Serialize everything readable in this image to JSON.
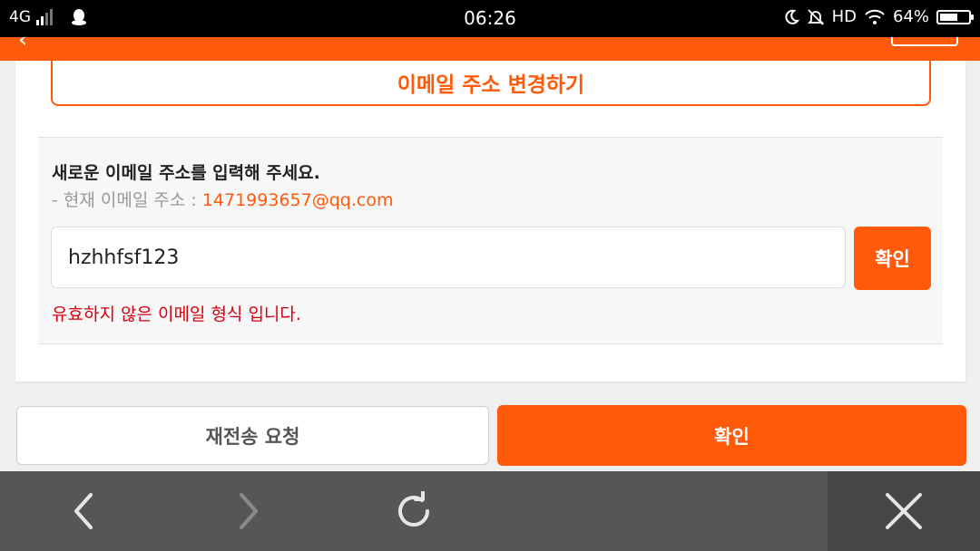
{
  "status_bar": {
    "network": "4G",
    "time": "06:26",
    "hd": "HD",
    "battery_text": "64%",
    "battery_level": 0.64,
    "icons": [
      "signal-icon",
      "qq-icon",
      "moon-icon",
      "mute-bell-icon",
      "wifi-icon",
      "battery-icon"
    ]
  },
  "header": {
    "icons": [
      "back-icon",
      "logo",
      "header-button"
    ]
  },
  "change_email": {
    "label": "이메일 주소 변경하기"
  },
  "form": {
    "heading": "새로운 이메일 주소를 입력해 주세요.",
    "current_label": "- 현재 이메일 주소 :",
    "current_email": "1471993657@qq.com",
    "input_value": "hzhhfsf123",
    "inline_confirm": "확인",
    "error": "유효하지 않은 이메일 형식 입니다."
  },
  "actions": {
    "resend": "재전송 요청",
    "confirm": "확인"
  },
  "browser_bar": {
    "icons": [
      "back-arrow-icon",
      "forward-arrow-icon",
      "refresh-icon",
      "close-icon"
    ]
  },
  "colors": {
    "brand": "#ff5a0a",
    "error": "#d6000f",
    "toolbar": "#565656"
  }
}
